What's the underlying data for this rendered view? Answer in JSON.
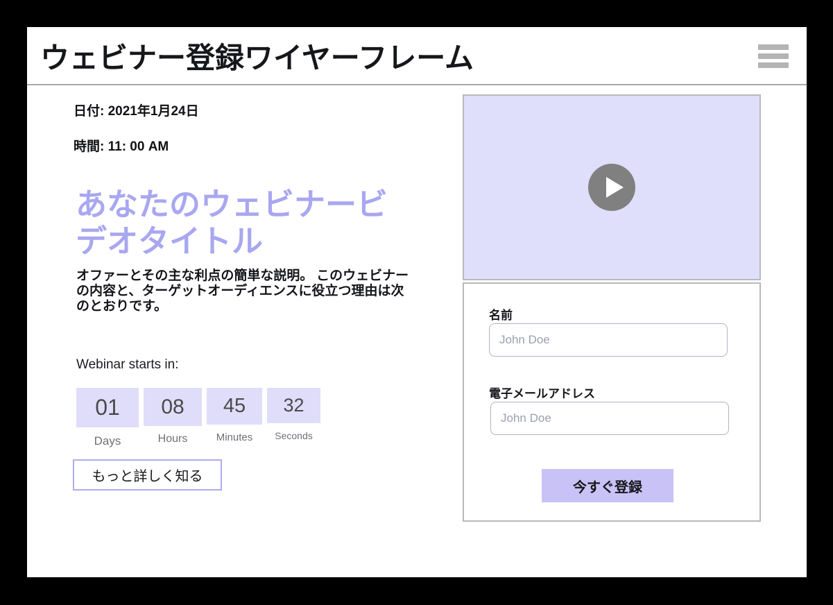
{
  "header": {
    "title": "ウェビナー登録ワイヤーフレーム",
    "menu_icon": "hamburger-menu-icon"
  },
  "left": {
    "date_line": "日付: 2021年1月24日",
    "time_line": "時間: 11: 00 AM",
    "heading": "あなたのウェビナービデオタイトル",
    "description": "オファーとその主な利点の簡単な説明。 このウェビナーの内容と、ターゲットオーディエンスに役立つ理由は次のとおりです。",
    "countdown_label": "Webinar starts in:",
    "countdown": [
      {
        "value": "01",
        "label": "Days"
      },
      {
        "value": "08",
        "label": "Hours"
      },
      {
        "value": "45",
        "label": "Minutes"
      },
      {
        "value": "32",
        "label": "Seconds"
      }
    ],
    "learn_more_label": "もっと詳しく知る"
  },
  "right": {
    "video": {
      "play_icon": "play-icon"
    },
    "form": {
      "name_label": "名前",
      "name_placeholder": "John Doe",
      "name_value": "",
      "email_label": "電子メールアドレス",
      "email_placeholder": "John Doe",
      "email_value": "",
      "submit_label": "今すぐ登録"
    }
  },
  "colors": {
    "accent_lavender": "#c8c2f7",
    "heading_purple": "#a9a7f0",
    "video_bg": "#dfdefb",
    "countdown_box": "#e0ddfa",
    "border_gray": "#b9b9b9",
    "page_bg": "#ffffff",
    "backdrop": "#000000"
  }
}
